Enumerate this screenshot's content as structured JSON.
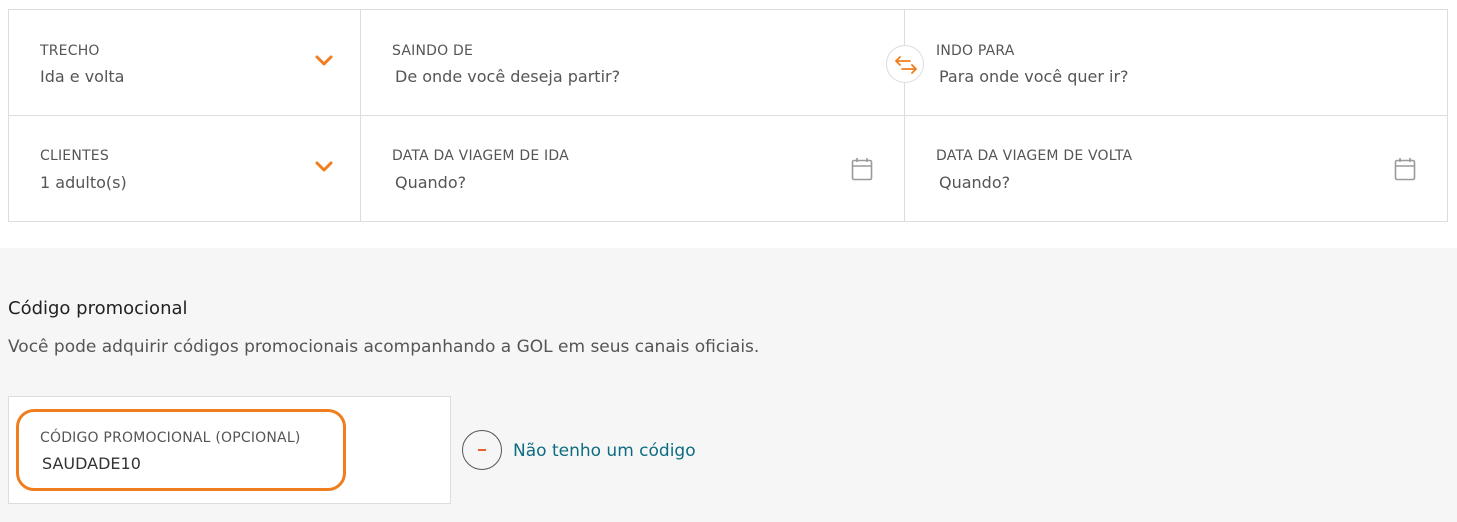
{
  "search": {
    "trecho": {
      "label": "TRECHO",
      "value": "Ida e volta"
    },
    "saindo": {
      "label": "SAINDO DE",
      "placeholder": "De onde você deseja partir?"
    },
    "indo": {
      "label": "INDO PARA",
      "placeholder": "Para onde você quer ir?"
    },
    "clientes": {
      "label": "CLIENTES",
      "value": "1 adulto(s)"
    },
    "data_ida": {
      "label": "DATA DA VIAGEM DE IDA",
      "placeholder": "Quando?"
    },
    "data_volta": {
      "label": "DATA DA VIAGEM DE VOLTA",
      "placeholder": "Quando?"
    }
  },
  "promo": {
    "title": "Código promocional",
    "description": "Você pode adquirir códigos promocionais acompanhando a GOL em seus canais oficiais.",
    "field_label": "CÓDIGO PROMOCIONAL (OPCIONAL)",
    "field_value": "SAUDADE10",
    "no_code_label": "Não tenho um código"
  },
  "icons": {
    "dropdown": "chevron-down-icon",
    "swap": "swap-arrows-icon",
    "calendar": "calendar-icon",
    "remove": "minus-circle-icon"
  },
  "colors": {
    "accent": "#f07d1e",
    "link": "#0d6d80",
    "highlight_border": "#f07d1e",
    "section_bg": "#f6f6f6"
  }
}
